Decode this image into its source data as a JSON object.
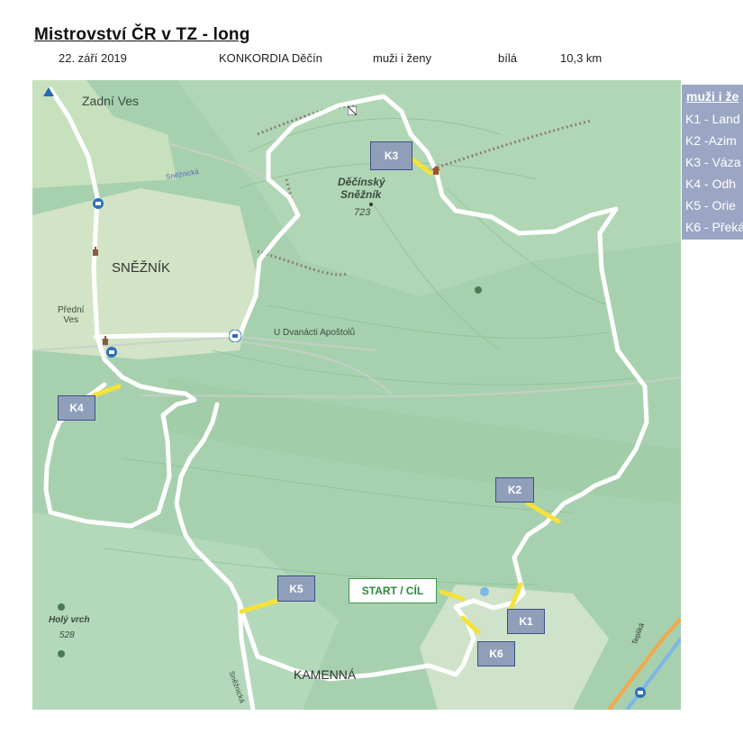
{
  "header": {
    "title": "Mistrovství ČR v TZ - long",
    "date": "22. září 2019",
    "organizer": "KONKORDIA Děčín",
    "category": "muži i ženy",
    "marking": "bílá",
    "length": "10,3 km"
  },
  "map": {
    "places": {
      "zadni_ves": "Zadní Ves",
      "sneznik": "SNĚŽNÍK",
      "predni_ves": "Přední\nVes",
      "summit_line1": "Děčínský",
      "summit_line2": "Sněžník",
      "summit_elev": "723",
      "u_dvanacti": "U Dvanácti Apoštolů",
      "holy_vrch": "Holý vrch",
      "holy_vrch_elev": "528",
      "kamenna": "KAMENNÁ",
      "sneznicka": "Sněžnická",
      "snezicka_top": "Sněžnická",
      "teplicka": "Tepliká"
    },
    "checkpoints": [
      {
        "id": "K1",
        "label": "K1"
      },
      {
        "id": "K2",
        "label": "K2"
      },
      {
        "id": "K3",
        "label": "K3"
      },
      {
        "id": "K4",
        "label": "K4"
      },
      {
        "id": "K5",
        "label": "K5"
      },
      {
        "id": "K6",
        "label": "K6"
      }
    ],
    "start_finish": "START / CÍL",
    "colors": {
      "route": "#ffffff",
      "marker": "#f5e23a",
      "checkpoint_fill": "#8f9fba",
      "checkpoint_border": "#3c4f86",
      "start_text": "#2b8a3b",
      "terrain": "#a9d3b0"
    }
  },
  "legend": {
    "heading": "muži i že",
    "items": [
      "K1 - Land",
      "K2 -Azim",
      "K3 - Váza",
      "K4 - Odh",
      "K5 - Orie",
      "K6 - Překá"
    ]
  }
}
